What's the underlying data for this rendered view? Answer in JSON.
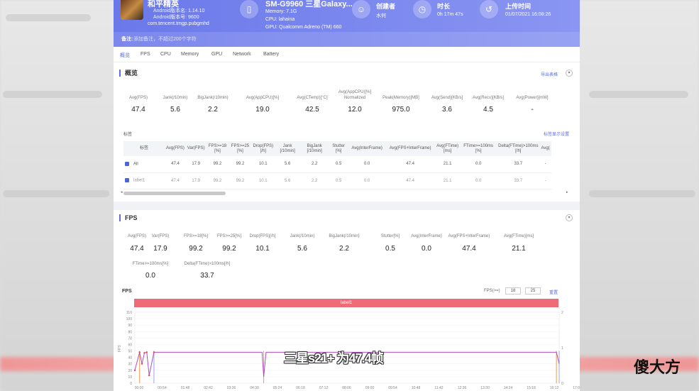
{
  "header": {
    "app_name": "和平精英",
    "app_version": "Android版本名: 1.14.10",
    "app_code": "Android版本号: 9600",
    "package": "com.tencent.tmgp.pubgmhd",
    "device_name": "SM-G9960 三星Galaxy...",
    "memory": "Memory: 7.1G",
    "cpu": "CPU: lahaina",
    "gpu": "GPU: Qualcomm Adreno (TM) 660",
    "creator_title": "创建者",
    "creator_value": "水何",
    "duration_title": "时长",
    "duration_value": "0h 17m 47s",
    "upload_title": "上传时间",
    "upload_value": "01/07/2021 16:08:26",
    "note_label": "备注:",
    "note_placeholder": "添加备注，不超过200个字符"
  },
  "tabs": [
    "概览",
    "FPS",
    "CPU",
    "Memory",
    "GPU",
    "Network",
    "Battery"
  ],
  "overview": {
    "title": "概览",
    "export_link": "导出表格",
    "metrics": [
      {
        "label": "Avg(FPS)",
        "value": "47.4"
      },
      {
        "label": "Jank(/10min)",
        "value": "5.6"
      },
      {
        "label": "BigJank(/10min)",
        "value": "2.2"
      },
      {
        "label": "Avg(AppCPU)[%]",
        "value": "19.0"
      },
      {
        "label": "Avg(CTemp)[°C]",
        "value": "42.5"
      },
      {
        "label": "Avg(AppCPU)[%] Normalized",
        "value": "12.0"
      },
      {
        "label": "Peak(Memory)[MB]",
        "value": "975.0"
      },
      {
        "label": "Avg(Send)[KB/s]",
        "value": "3.6"
      },
      {
        "label": "Avg(Recv)[KB/s]",
        "value": "4.5"
      },
      {
        "label": "Avg(Power)[mW]",
        "value": "-"
      }
    ],
    "tags_title": "标签",
    "tags_settings": "标签显示设置",
    "table_headers": [
      "标签",
      "Avg(FPS)",
      "Var(FPS)",
      "FPS>=18 [%]",
      "FPS>=25 [%]",
      "Drop(FPS) [/h]",
      "Jank [/10min]",
      "BigJank [/10min]",
      "Stutter [%]",
      "Avg(InterFrame)",
      "Avg(FPS+InterFrame)",
      "Avg(FTime) [ms]",
      "FTime>=100ms [%]",
      "Delta(FTime)>100ms [/h]",
      "Avg("
    ],
    "table_rows": [
      [
        "All",
        "47.4",
        "17.9",
        "99.2",
        "99.2",
        "10.1",
        "5.6",
        "2.2",
        "0.5",
        "0.0",
        "47.4",
        "21.1",
        "0.0",
        "33.7",
        "-"
      ],
      [
        "label1",
        "47.4",
        "17.9",
        "99.2",
        "99.2",
        "10.1",
        "5.6",
        "2.2",
        "0.5",
        "0.0",
        "47.4",
        "21.1",
        "0.0",
        "33.7",
        "-"
      ]
    ]
  },
  "fps_section": {
    "title": "FPS",
    "metrics_row1": [
      {
        "label": "Avg(FPS)",
        "value": "47.4"
      },
      {
        "label": "Var(FPS)",
        "value": "17.9"
      },
      {
        "label": "FPS>=18[%]",
        "value": "99.2"
      },
      {
        "label": "FPS>=25[%]",
        "value": "99.2"
      },
      {
        "label": "Drop(FPS)[/h]",
        "value": "10.1"
      },
      {
        "label": "Jank(/10min)",
        "value": "5.6"
      },
      {
        "label": "BigJank(/10min)",
        "value": "2.2"
      },
      {
        "label": "Stutter[%]",
        "value": "0.5"
      },
      {
        "label": "Avg(InterFrame)",
        "value": "0.0"
      },
      {
        "label": "Avg(FPS+InterFrame)",
        "value": "47.4"
      },
      {
        "label": "Avg(FTime)[ms]",
        "value": "21.1"
      }
    ],
    "metrics_row2": [
      {
        "label": "FTime>=100ms[%]",
        "value": "0.0"
      },
      {
        "label": "Delta(FTime)>100ms[/h]",
        "value": "33.7"
      }
    ],
    "chart_title": "FPS",
    "fps_filter_label": "FPS(>=)",
    "fps_filter_1": "18",
    "fps_filter_2": "25",
    "reset_link": "重置",
    "legend_label": "label1"
  },
  "chart_data": {
    "type": "line",
    "title": "FPS",
    "ylabel": "FPS",
    "ylim": [
      0,
      110
    ],
    "y2lim": [
      0,
      2
    ],
    "y_ticks": [
      "110",
      "100",
      "90",
      "80",
      "70",
      "60",
      "50",
      "40",
      "30",
      "20",
      "10",
      "0"
    ],
    "y2_ticks": [
      "2",
      "1",
      "0"
    ],
    "x_ticks": [
      "00:00",
      "00:54",
      "01:48",
      "02:42",
      "03:36",
      "04:30",
      "05:24",
      "06:18",
      "07:12",
      "08:06",
      "09:00",
      "09:54",
      "10:48",
      "11:42",
      "12:36",
      "13:30",
      "14:24",
      "15:18",
      "16:12",
      "17:06"
    ],
    "series": [
      {
        "name": "FPS",
        "color": "#b04cc2",
        "x": [
          0,
          12,
          18,
          24,
          30,
          36,
          48,
          60,
          120,
          240,
          320,
          324,
          330,
          400,
          560,
          700,
          860,
          1000,
          1060,
          1067
        ],
        "values": [
          20,
          48,
          30,
          47,
          48,
          12,
          48,
          48,
          48,
          48,
          48,
          10,
          48,
          48,
          48,
          48,
          48,
          48,
          48,
          30
        ]
      }
    ]
  },
  "overlay": {
    "subtitle": "三星s21+ 为47.4帧",
    "watermark": "傻大方"
  }
}
